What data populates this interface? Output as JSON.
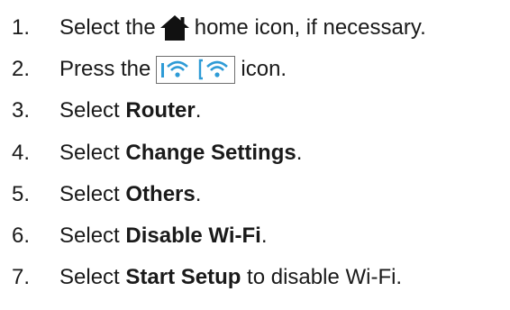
{
  "steps": [
    {
      "num": "1.",
      "pre": "Select the",
      "post": "home icon, if necessary.",
      "icon": "home-icon"
    },
    {
      "num": "2.",
      "pre": "Press the",
      "post": "icon.",
      "icon": "wifi-status-icon",
      "accent": "#2e9bd6"
    },
    {
      "num": "3.",
      "pre": "Select ",
      "bold": "Router",
      "post": "."
    },
    {
      "num": "4.",
      "pre": "Select ",
      "bold": "Change Settings",
      "post": "."
    },
    {
      "num": "5.",
      "pre": "Select ",
      "bold": "Others",
      "post": "."
    },
    {
      "num": "6.",
      "pre": "Select ",
      "bold": "Disable Wi-Fi",
      "post": "."
    },
    {
      "num": "7.",
      "pre": "Select ",
      "bold": "Start Setup",
      "post": " to disable Wi-Fi."
    }
  ]
}
